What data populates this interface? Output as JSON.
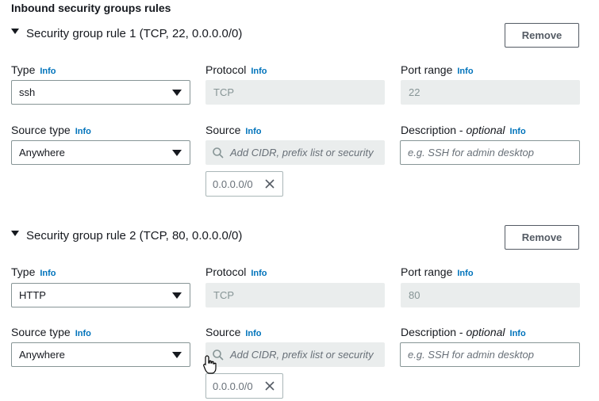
{
  "section_title": "Inbound security groups rules",
  "rules": [
    {
      "title": "Security group rule 1 (TCP, 22, 0.0.0.0/0)",
      "remove_label": "Remove",
      "type_label": "Type",
      "type_value": "ssh",
      "protocol_label": "Protocol",
      "protocol_value": "TCP",
      "port_label": "Port range",
      "port_value": "22",
      "source_type_label": "Source type",
      "source_type_value": "Anywhere",
      "source_label": "Source",
      "source_placeholder": "Add CIDR, prefix list or security",
      "description_label": "Description - ",
      "description_optional": "optional",
      "description_placeholder": "e.g. SSH for admin desktop",
      "token_value": "0.0.0.0/0",
      "info": "Info"
    },
    {
      "title": "Security group rule 2 (TCP, 80, 0.0.0.0/0)",
      "remove_label": "Remove",
      "type_label": "Type",
      "type_value": "HTTP",
      "protocol_label": "Protocol",
      "protocol_value": "TCP",
      "port_label": "Port range",
      "port_value": "80",
      "source_type_label": "Source type",
      "source_type_value": "Anywhere",
      "source_label": "Source",
      "source_placeholder": "Add CIDR, prefix list or security",
      "description_label": "Description - ",
      "description_optional": "optional",
      "description_placeholder": "e.g. SSH for admin desktop",
      "token_value": "0.0.0.0/0",
      "info": "Info"
    }
  ],
  "colors": {
    "link": "#0073bb",
    "text": "#16191f",
    "disabled_bg": "#eaeded",
    "border": "#879596"
  },
  "icons": {
    "expand": "caret-down-icon",
    "search": "search-icon",
    "remove_token": "close-icon",
    "cursor": "hand-pointer-icon"
  }
}
